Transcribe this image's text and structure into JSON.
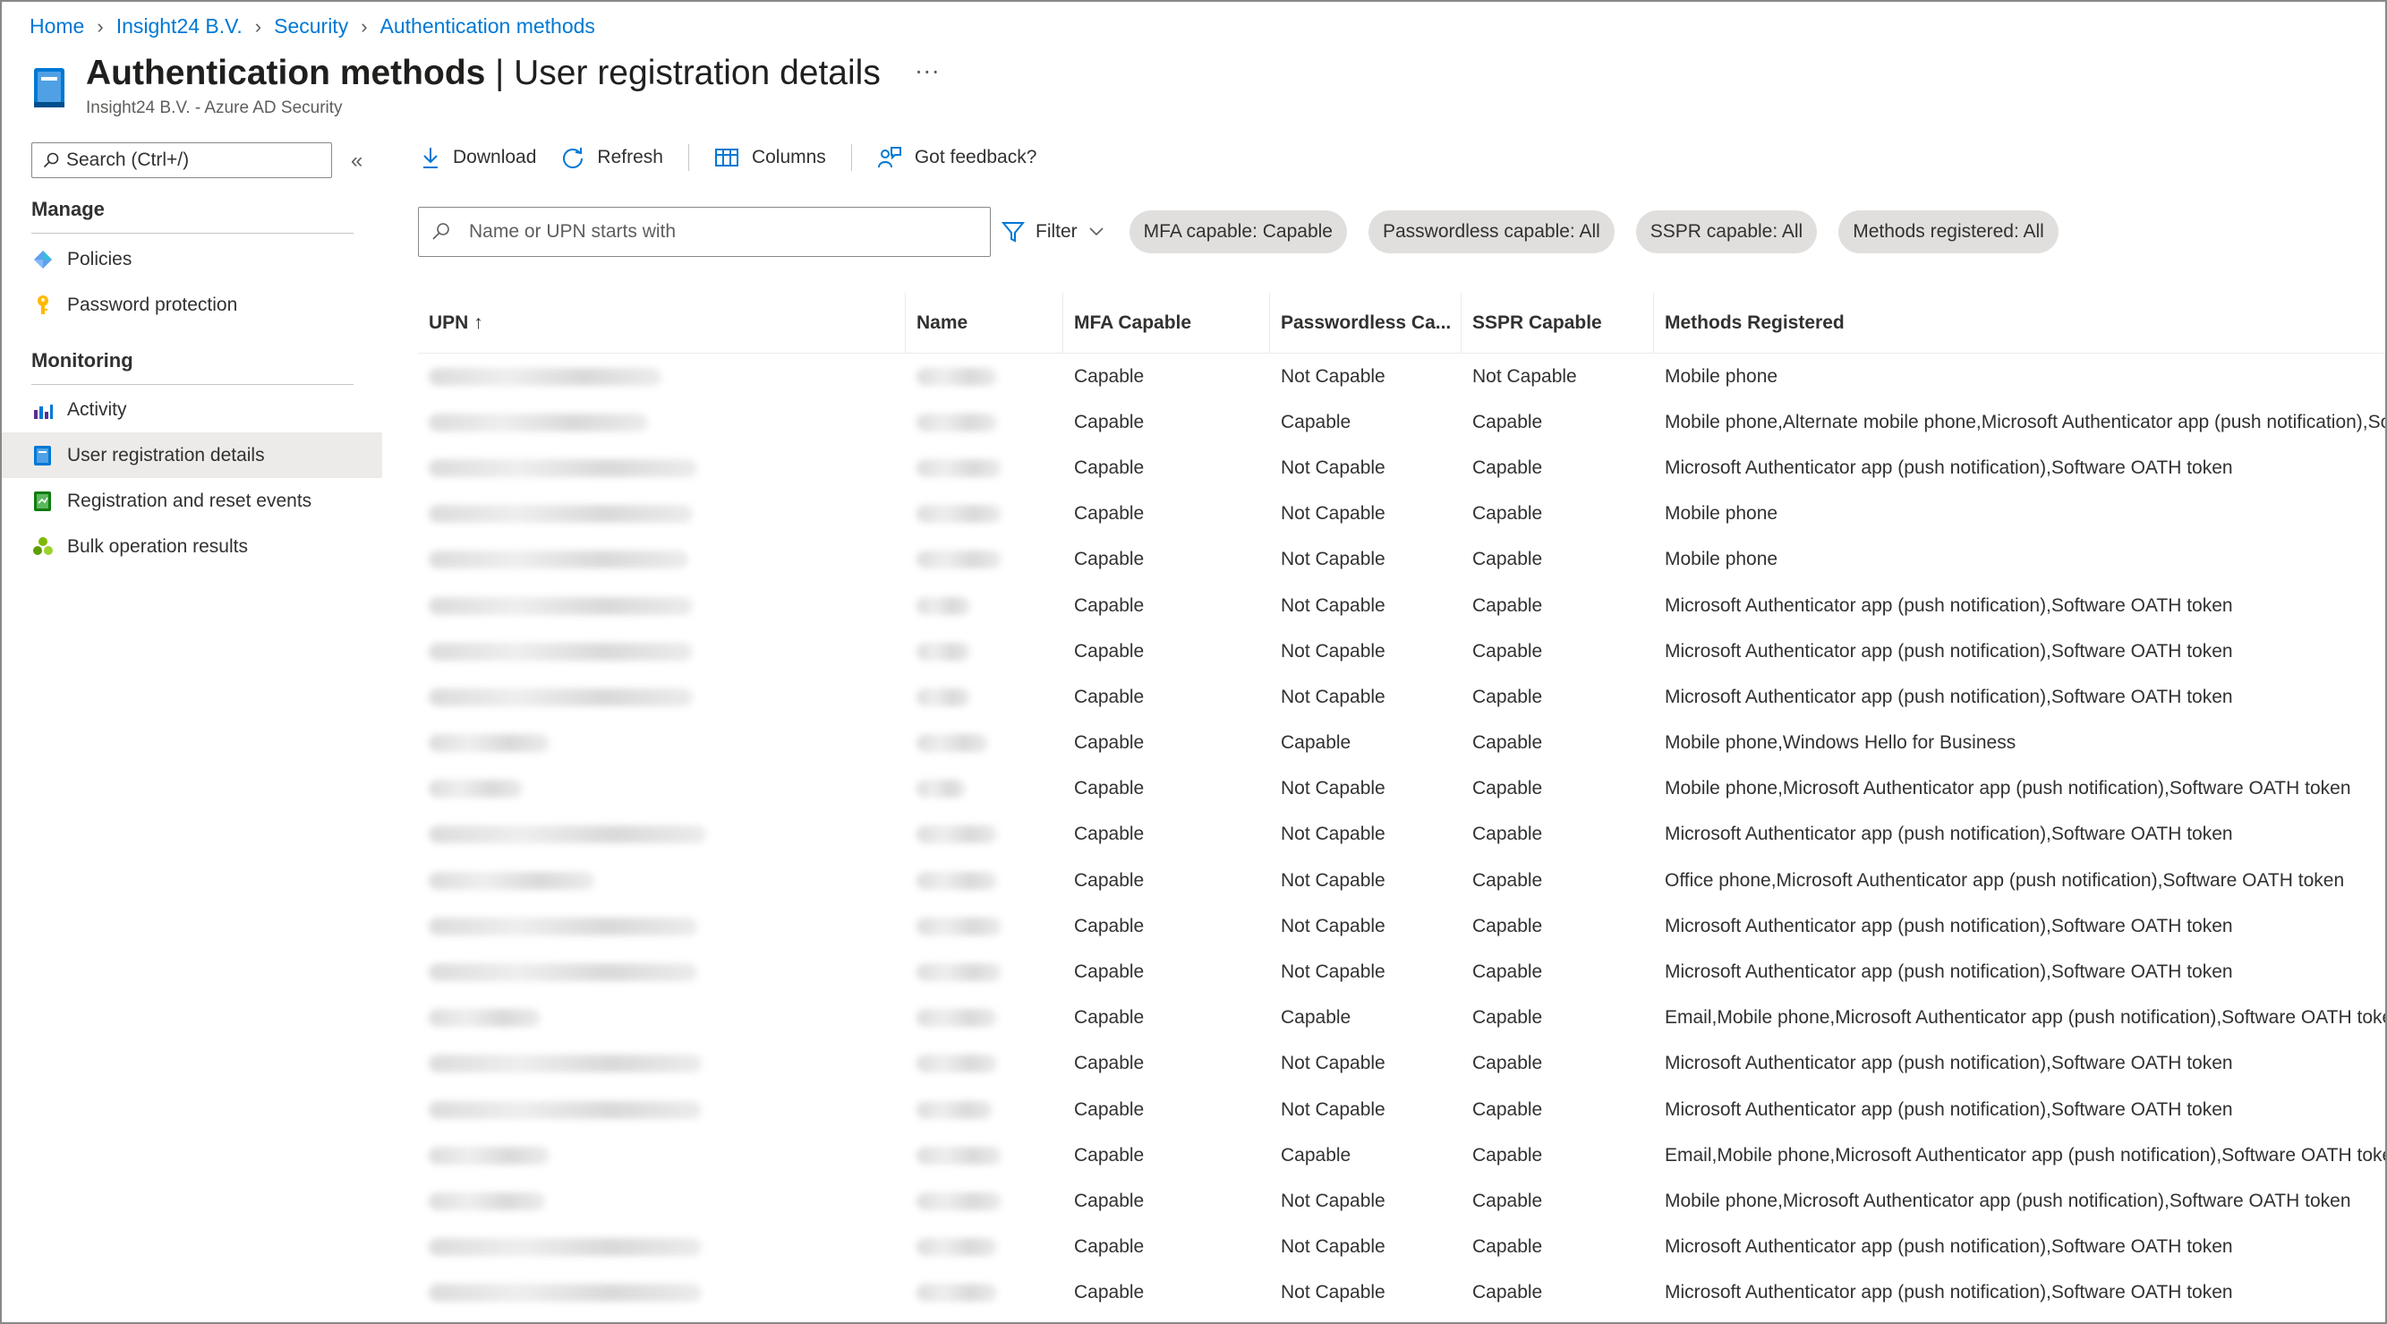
{
  "breadcrumb": [
    "Home",
    "Insight24 B.V.",
    "Security",
    "Authentication methods"
  ],
  "header": {
    "title_bold": "Authentication methods",
    "title_rest": " | User registration details",
    "more": "···",
    "subtitle": "Insight24 B.V. - Azure AD Security"
  },
  "sidebar": {
    "search_placeholder": "Search (Ctrl+/)",
    "collapse": "«",
    "sections": [
      {
        "title": "Manage",
        "items": [
          {
            "label": "Policies",
            "icon": "policies-icon"
          },
          {
            "label": "Password protection",
            "icon": "key-icon"
          }
        ]
      },
      {
        "title": "Monitoring",
        "items": [
          {
            "label": "Activity",
            "icon": "activity-chart-icon"
          },
          {
            "label": "User registration details",
            "icon": "registration-book-icon",
            "selected": true
          },
          {
            "label": "Registration and reset events",
            "icon": "events-icon"
          },
          {
            "label": "Bulk operation results",
            "icon": "bulk-operation-icon"
          }
        ]
      }
    ]
  },
  "toolbar": {
    "download": "Download",
    "refresh": "Refresh",
    "columns": "Columns",
    "feedback": "Got feedback?"
  },
  "filters": {
    "search_placeholder": "Name or UPN starts with",
    "filter_label": "Filter",
    "pills": [
      "MFA capable: Capable",
      "Passwordless capable: All",
      "SSPR capable: All",
      "Methods registered: All"
    ]
  },
  "table": {
    "columns": [
      "UPN ↑",
      "Name",
      "MFA Capable",
      "Passwordless Ca...",
      "SSPR Capable",
      "Methods Registered"
    ],
    "rows": [
      [
        "Capable",
        "Not Capable",
        "Not Capable",
        "Mobile phone"
      ],
      [
        "Capable",
        "Capable",
        "Capable",
        "Mobile phone,Alternate mobile phone,Microsoft Authenticator app (push notification),So"
      ],
      [
        "Capable",
        "Not Capable",
        "Capable",
        "Microsoft Authenticator app (push notification),Software OATH token"
      ],
      [
        "Capable",
        "Not Capable",
        "Capable",
        "Mobile phone"
      ],
      [
        "Capable",
        "Not Capable",
        "Capable",
        "Mobile phone"
      ],
      [
        "Capable",
        "Not Capable",
        "Capable",
        "Microsoft Authenticator app (push notification),Software OATH token"
      ],
      [
        "Capable",
        "Not Capable",
        "Capable",
        "Microsoft Authenticator app (push notification),Software OATH token"
      ],
      [
        "Capable",
        "Not Capable",
        "Capable",
        "Microsoft Authenticator app (push notification),Software OATH token"
      ],
      [
        "Capable",
        "Capable",
        "Capable",
        "Mobile phone,Windows Hello for Business"
      ],
      [
        "Capable",
        "Not Capable",
        "Capable",
        "Mobile phone,Microsoft Authenticator app (push notification),Software OATH token"
      ],
      [
        "Capable",
        "Not Capable",
        "Capable",
        "Microsoft Authenticator app (push notification),Software OATH token"
      ],
      [
        "Capable",
        "Not Capable",
        "Capable",
        "Office phone,Microsoft Authenticator app (push notification),Software OATH token"
      ],
      [
        "Capable",
        "Not Capable",
        "Capable",
        "Microsoft Authenticator app (push notification),Software OATH token"
      ],
      [
        "Capable",
        "Not Capable",
        "Capable",
        "Microsoft Authenticator app (push notification),Software OATH token"
      ],
      [
        "Capable",
        "Capable",
        "Capable",
        "Email,Mobile phone,Microsoft Authenticator app (push notification),Software OATH toke"
      ],
      [
        "Capable",
        "Not Capable",
        "Capable",
        "Microsoft Authenticator app (push notification),Software OATH token"
      ],
      [
        "Capable",
        "Not Capable",
        "Capable",
        "Microsoft Authenticator app (push notification),Software OATH token"
      ],
      [
        "Capable",
        "Capable",
        "Capable",
        "Email,Mobile phone,Microsoft Authenticator app (push notification),Software OATH toke"
      ],
      [
        "Capable",
        "Not Capable",
        "Capable",
        "Mobile phone,Microsoft Authenticator app (push notification),Software OATH token"
      ],
      [
        "Capable",
        "Not Capable",
        "Capable",
        "Microsoft Authenticator app (push notification),Software OATH token"
      ],
      [
        "Capable",
        "Not Capable",
        "Capable",
        "Microsoft Authenticator app (push notification),Software OATH token"
      ]
    ]
  },
  "colors": {
    "accent": "#0078d4",
    "selected_bg": "#edebe9",
    "pill_bg": "#e1dfdd"
  }
}
